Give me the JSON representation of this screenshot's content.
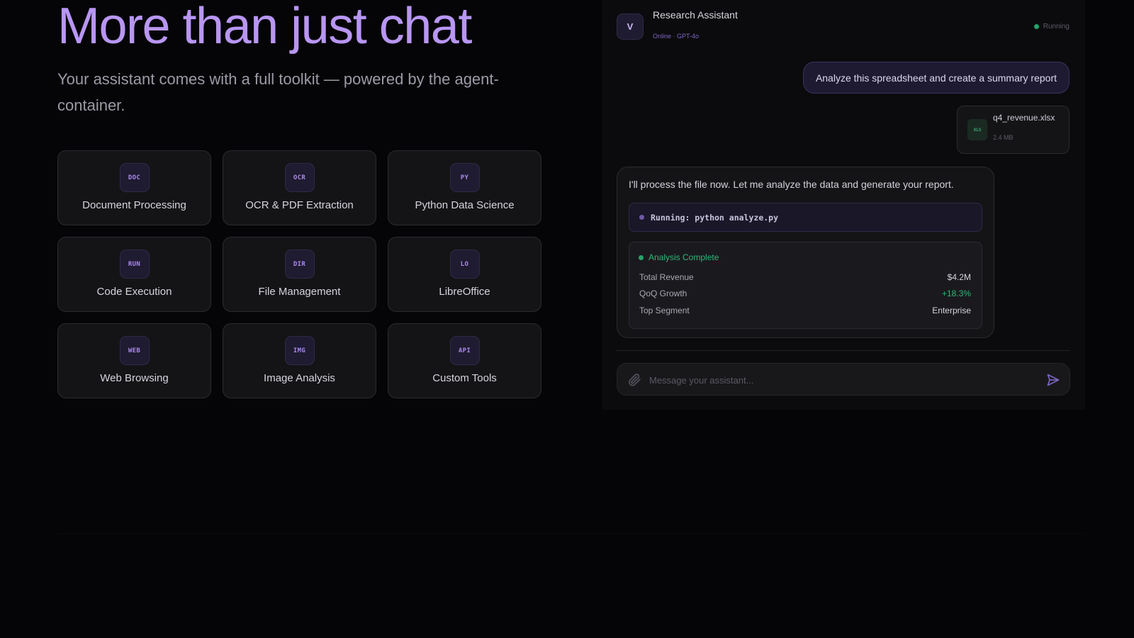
{
  "hero": {
    "title": "More than just chat",
    "subtitle": "Your assistant comes with a full toolkit — powered by the agent-container."
  },
  "tools": [
    {
      "code": "DOC",
      "label": "Document Processing"
    },
    {
      "code": "OCR",
      "label": "OCR & PDF Extraction"
    },
    {
      "code": "PY",
      "label": "Python Data Science"
    },
    {
      "code": "RUN",
      "label": "Code Execution"
    },
    {
      "code": "DIR",
      "label": "File Management"
    },
    {
      "code": "LO",
      "label": "LibreOffice"
    },
    {
      "code": "WEB",
      "label": "Web Browsing"
    },
    {
      "code": "IMG",
      "label": "Image Analysis"
    },
    {
      "code": "API",
      "label": "Custom Tools"
    }
  ],
  "chat": {
    "avatar_letter": "V",
    "name": "Research Assistant",
    "status": "Online · GPT-4o",
    "running_label": "Running",
    "user_message": "Analyze this spreadsheet and create a summary report",
    "file": {
      "icon_code": "XLS",
      "name": "q4_revenue.xlsx",
      "size": "2.4 MB"
    },
    "bot_message": "I'll process the file now. Let me analyze the data and generate your report.",
    "run_command": "Running: python analyze.py",
    "result": {
      "title": "Analysis Complete",
      "rows": [
        {
          "label": "Total Revenue",
          "value": "$4.2M"
        },
        {
          "label": "QoQ Growth",
          "value": "+18.3%"
        },
        {
          "label": "Top Segment",
          "value": "Enterprise"
        }
      ]
    },
    "composer_placeholder": "Message your assistant..."
  },
  "colors": {
    "accent": "#b896f2",
    "success": "#2fb679",
    "background": "#050507"
  },
  "icons": {
    "attach": "paperclip-icon",
    "send": "send-icon",
    "status": "status-dot-icon"
  }
}
